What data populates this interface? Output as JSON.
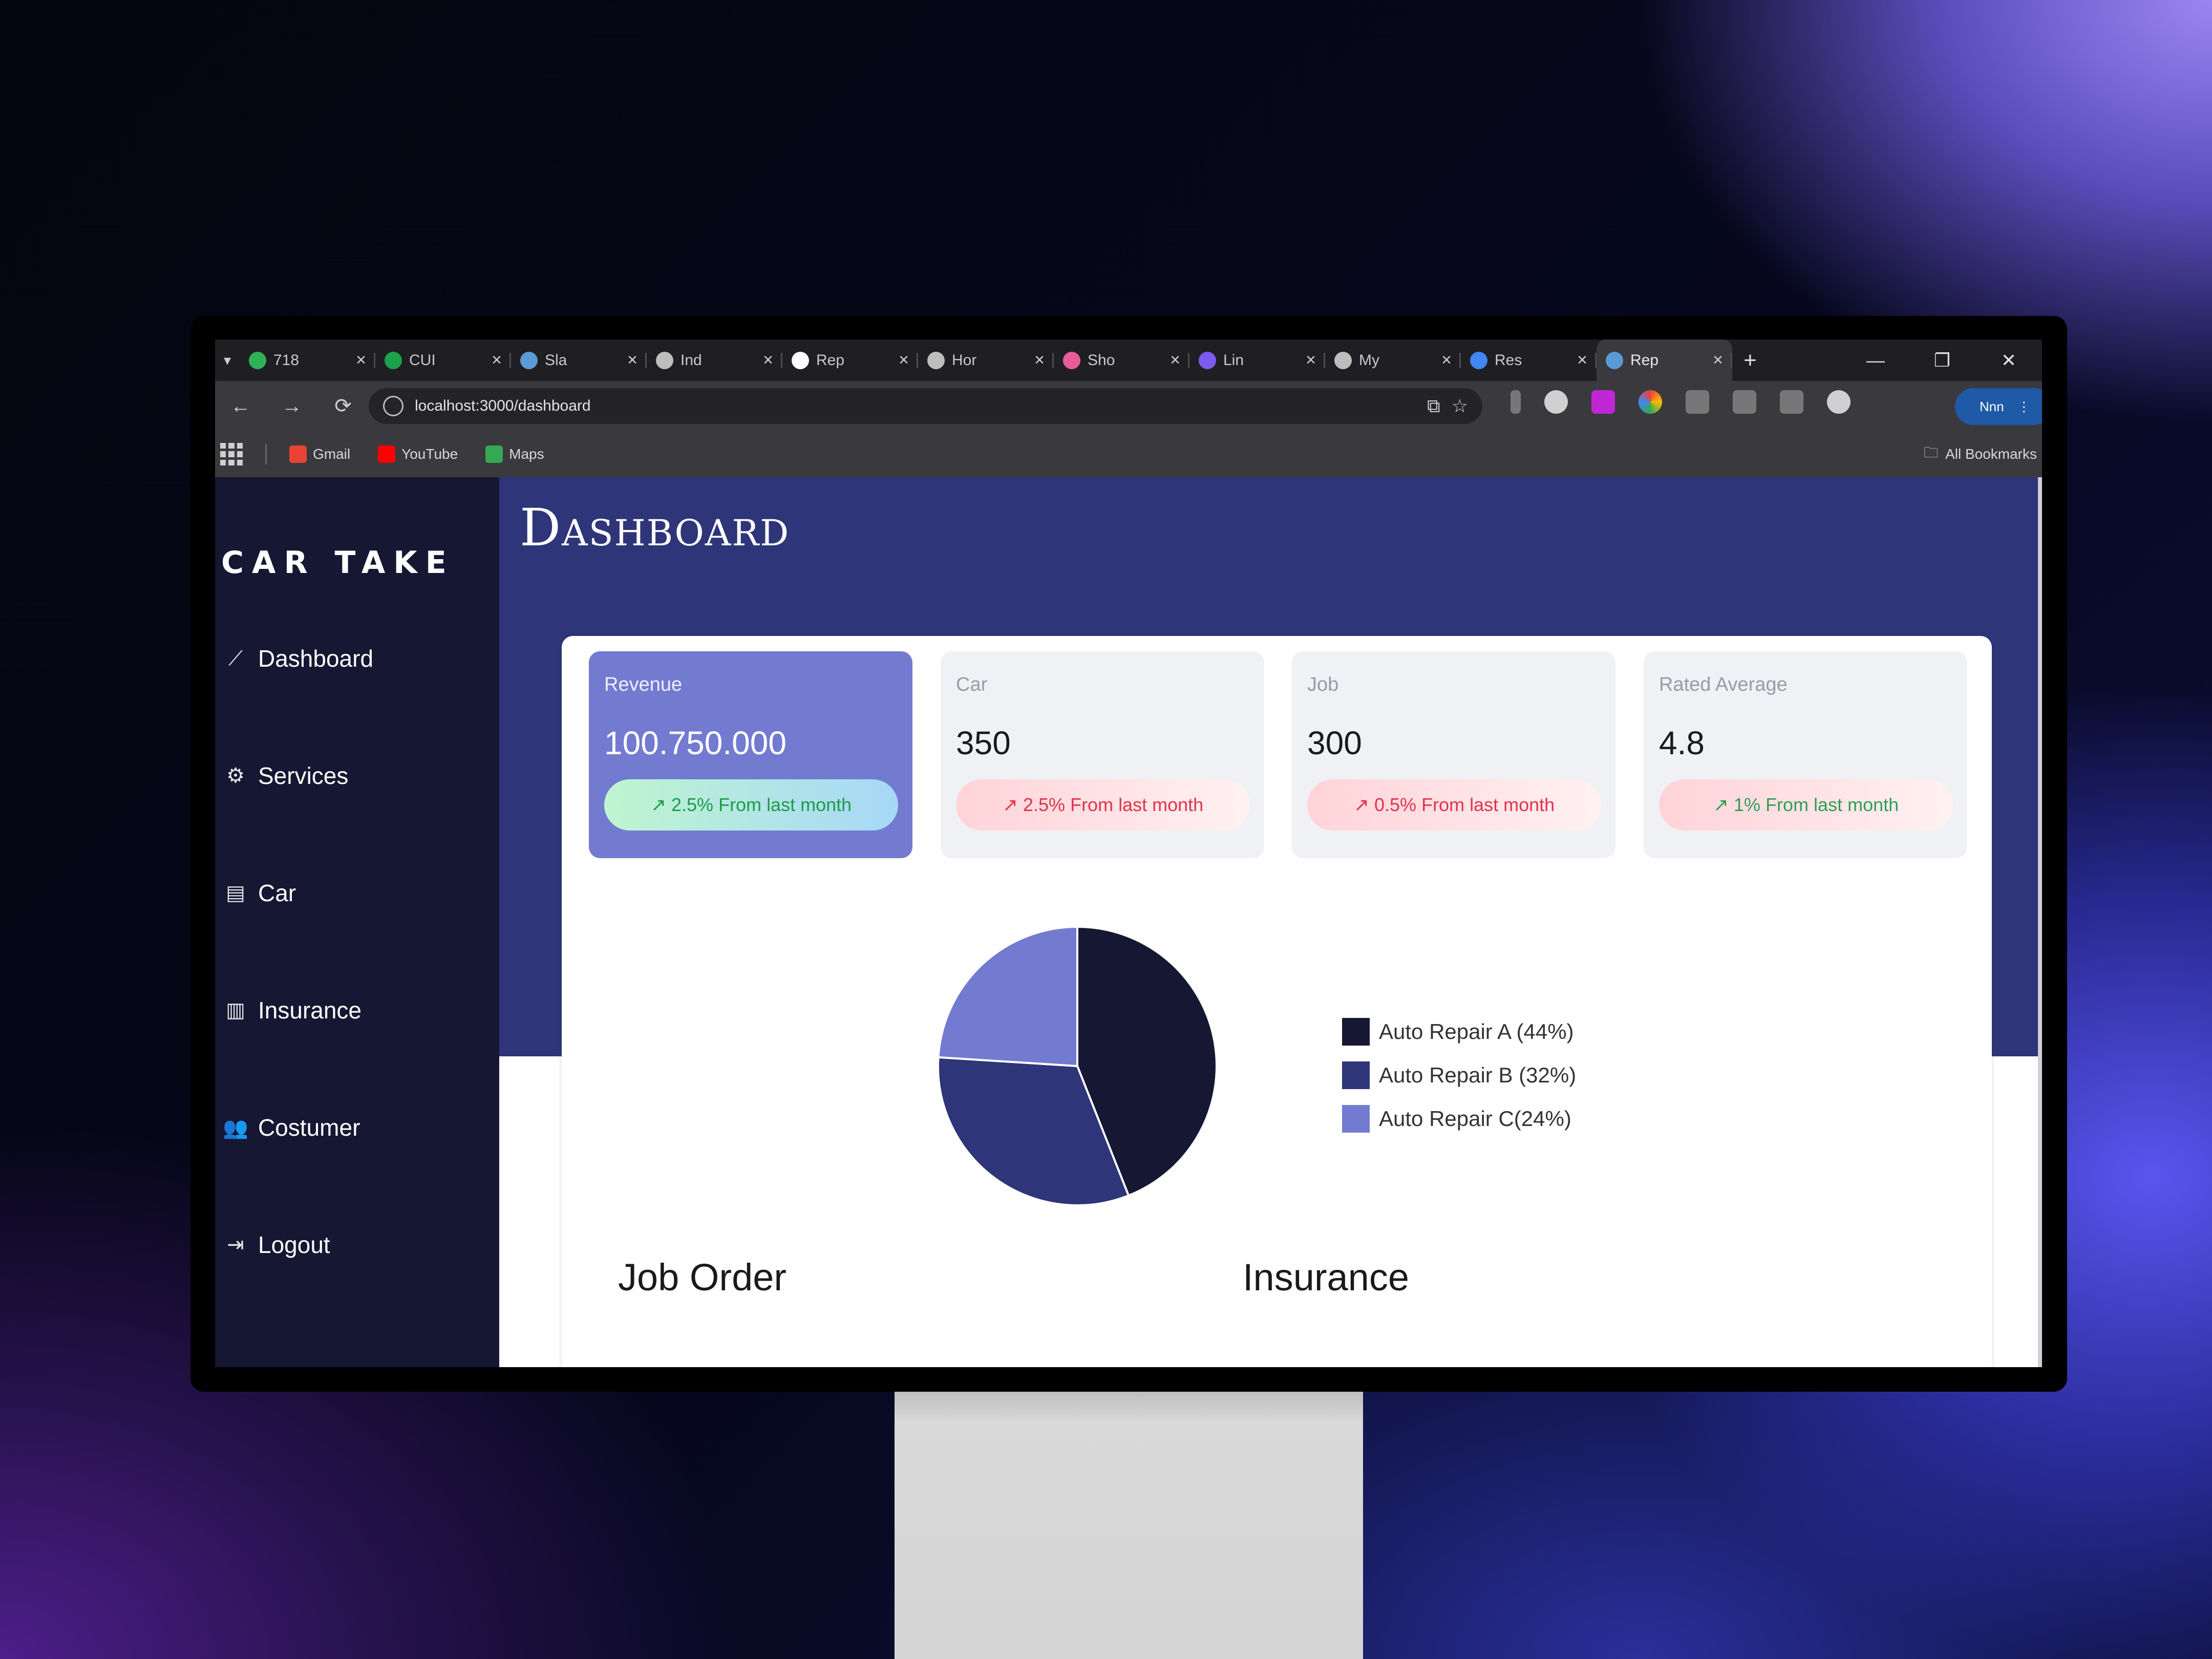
{
  "browser": {
    "tabs": [
      {
        "title": "718",
        "color": "#2fb157"
      },
      {
        "title": "CUI",
        "color": "#1aa34a"
      },
      {
        "title": "Sla",
        "color": "#5b9bd5"
      },
      {
        "title": "Ind",
        "color": "#bdbdbd"
      },
      {
        "title": "Rep",
        "color": "#ffffff"
      },
      {
        "title": "Hor",
        "color": "#bdbdbd"
      },
      {
        "title": "Sho",
        "color": "#e85c9a"
      },
      {
        "title": "Lin",
        "color": "#7b5cf0"
      },
      {
        "title": "My",
        "color": "#bdbdbd"
      },
      {
        "title": "Res",
        "color": "#4285f4"
      },
      {
        "title": "Rep",
        "color": "#5b9bd5",
        "active": true
      }
    ],
    "url": "localhost:3000/dashboard",
    "profile_label": "Nnn",
    "bookmarks": [
      {
        "label": "Gmail",
        "color": "#ea4335"
      },
      {
        "label": "YouTube",
        "color": "#ff0000"
      },
      {
        "label": "Maps",
        "color": "#34a853"
      }
    ],
    "all_bookmarks": "All Bookmarks"
  },
  "sidebar": {
    "brand": "CAR TAKE",
    "items": [
      {
        "label": "Dashboard",
        "icon": "chart-line-icon"
      },
      {
        "label": "Services",
        "icon": "gears-icon"
      },
      {
        "label": "Car",
        "icon": "car-icon"
      },
      {
        "label": "Insurance",
        "icon": "chart-box-icon"
      },
      {
        "label": "Costumer",
        "icon": "users-icon"
      },
      {
        "label": "Logout",
        "icon": "logout-icon"
      }
    ]
  },
  "page": {
    "title": "Dashboard"
  },
  "stats": [
    {
      "label": "Revenue",
      "value": "100.750.000",
      "change": "2.5% From last month",
      "trend": "up"
    },
    {
      "label": "Car",
      "value": "350",
      "change": "2.5% From last month",
      "trend": "down"
    },
    {
      "label": "Job",
      "value": "300",
      "change": "0.5% From last month",
      "trend": "down"
    },
    {
      "label": "Rated Average",
      "value": "4.8",
      "change": "1% From last month",
      "trend": "up"
    }
  ],
  "chart_data": {
    "type": "pie",
    "labels": [
      "Auto Repair A",
      "Auto Repair B",
      "Auto Repair C"
    ],
    "values": [
      44,
      32,
      24
    ],
    "legend": [
      "Auto Repair A (44%)",
      "Auto Repair B (32%)",
      "Auto Repair C(24%)"
    ],
    "colors": [
      "#161732",
      "#2f3579",
      "#737bd0"
    ],
    "legend_position": "right"
  },
  "sections": {
    "job_order": "Job Order",
    "insurance": "Insurance"
  }
}
